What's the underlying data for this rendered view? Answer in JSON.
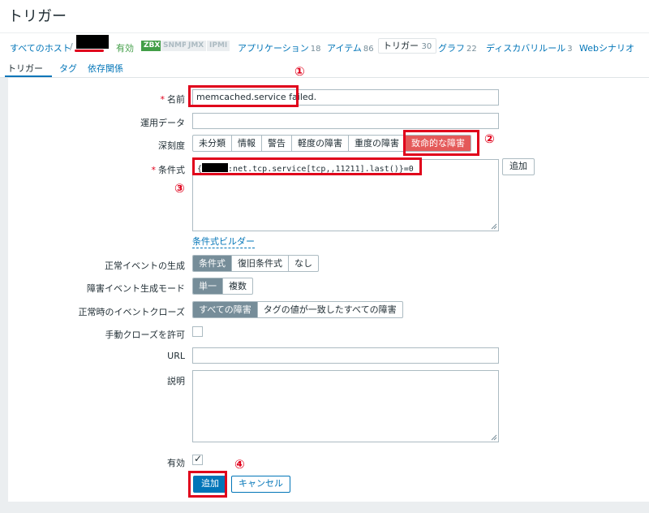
{
  "page": {
    "title": "トリガー"
  },
  "breadcrumb": {
    "all_hosts": "すべてのホスト",
    "separator": "/",
    "status": "有効",
    "availability": [
      "ZBX",
      "SNMP",
      "JMX",
      "IPMI"
    ],
    "links": [
      {
        "label": "アプリケーション",
        "count": "18"
      },
      {
        "label": "アイテム",
        "count": "86"
      },
      {
        "label": "トリガー",
        "count": "30"
      },
      {
        "label": "グラフ",
        "count": "22"
      },
      {
        "label": "ディスカバリルール",
        "count": "3"
      },
      {
        "label": "Webシナリオ",
        "count": ""
      }
    ]
  },
  "tabs": [
    "トリガー",
    "タグ",
    "依存関係"
  ],
  "form": {
    "name": {
      "label": "名前",
      "value": "memcached.service failed."
    },
    "opdata": {
      "label": "運用データ",
      "value": ""
    },
    "severity": {
      "label": "深刻度",
      "options": [
        "未分類",
        "情報",
        "警告",
        "軽度の障害",
        "重度の障害",
        "致命的な障害"
      ],
      "selected": "致命的な障害"
    },
    "expression": {
      "label": "条件式",
      "open": "{",
      "value": ":net.tcp.service[tcp,,11211].last()}=0",
      "add_button": "追加",
      "builder_link": "条件式ビルダー"
    },
    "ok_event_gen": {
      "label": "正常イベントの生成",
      "options": [
        "条件式",
        "復旧条件式",
        "なし"
      ],
      "selected": "条件式"
    },
    "problem_mode": {
      "label": "障害イベント生成モード",
      "options": [
        "単一",
        "複数"
      ],
      "selected": "単一"
    },
    "ok_close": {
      "label": "正常時のイベントクローズ",
      "options": [
        "すべての障害",
        "タグの値が一致したすべての障害"
      ],
      "selected": "すべての障害"
    },
    "manual_close": {
      "label": "手動クローズを許可",
      "checked": false
    },
    "url": {
      "label": "URL",
      "value": ""
    },
    "description": {
      "label": "説明",
      "value": ""
    },
    "enabled": {
      "label": "有効",
      "checked": true
    },
    "submit": "追加",
    "cancel": "キャンセル"
  },
  "annotations": [
    "①",
    "②",
    "③",
    "④"
  ],
  "colors": {
    "accent": "#0275b8",
    "highlight": "#e0001b",
    "disaster": "#e45959",
    "enabled": "#429e47"
  }
}
